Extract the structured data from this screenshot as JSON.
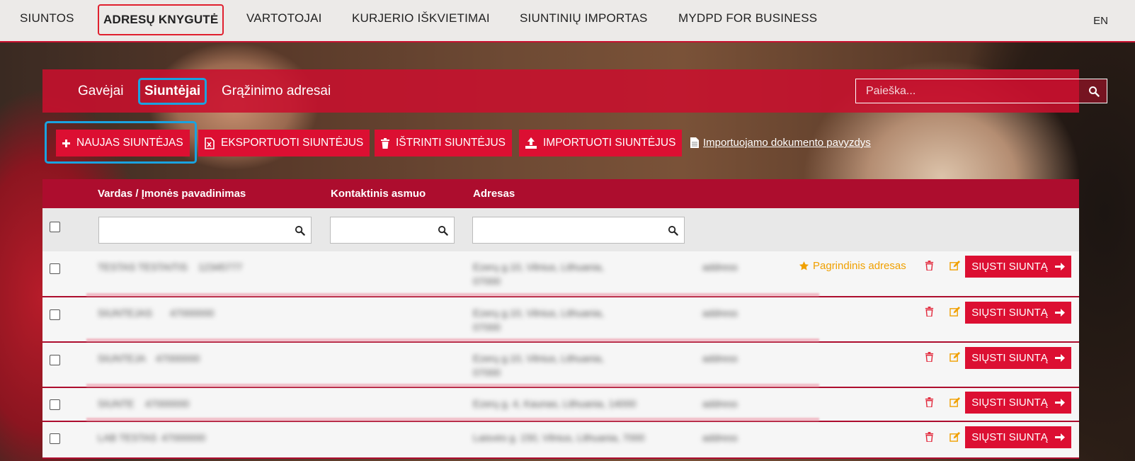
{
  "topnav": {
    "items": [
      "SIUNTOS",
      "ADRESŲ KNYGUTĖ",
      "VARTOTOJAI",
      "KURJERIO IŠKVIETIMAI",
      "SIUNTINIŲ IMPORTAS",
      "MYDPD FOR BUSINESS"
    ],
    "active_index": 1,
    "lang": "EN"
  },
  "subnav": {
    "tabs": [
      "Gavėjai",
      "Siuntėjai",
      "Grąžinimo adresai"
    ],
    "active_index": 1,
    "search_placeholder": "Paieška..."
  },
  "actions": {
    "new": "NAUJAS SIUNTĖJAS",
    "export": "EKSPORTUOTI SIUNTĖJUS",
    "delete": "IŠTRINTI SIUNTĖJUS",
    "import": "IMPORTUOTI SIUNTĖJUS",
    "doc_link": "Importuojamo dokumento pavyzdys"
  },
  "table": {
    "columns": [
      "Vardas / Įmonės pavadinimas",
      "Kontaktinis asmuo",
      "Adresas"
    ],
    "primary_label": "Pagrindinis adresas",
    "send_label": "SIŲSTI SIUNTĄ",
    "rows": [
      {
        "name": "TESTAS TESTAITIS",
        "code": "12345777",
        "address": "Ezerų g.10, Vilnius, Lithuania,",
        "address2": "07000",
        "extra": "address",
        "primary": true
      },
      {
        "name": "SIUNTEJAS",
        "code": "47000000",
        "address": "Ezerų g.10, Vilnius, Lithuania,",
        "address2": "07000",
        "extra": "address",
        "primary": false
      },
      {
        "name": "SIUNTEJA",
        "code": "47000000",
        "address": "Ezerų g.10, Vilnius, Lithuania,",
        "address2": "07000",
        "extra": "address",
        "primary": false
      },
      {
        "name": "SIUNTE",
        "code": "47000000",
        "address": "Ezerų g. 4, Kaunas, Lithuania, 14000",
        "address2": "",
        "extra": "address",
        "primary": false
      },
      {
        "name": "LAB TESTAS",
        "code": "47000000",
        "address": "Laisvės g. 150, Vilnius, Lithuania, 7000",
        "address2": "",
        "extra": "address",
        "primary": false
      }
    ]
  },
  "colors": {
    "brand_red": "#dc0f32",
    "header_red": "#ad0d2e",
    "highlight_blue": "#1aa3e0",
    "star_orange": "#f0a000"
  }
}
